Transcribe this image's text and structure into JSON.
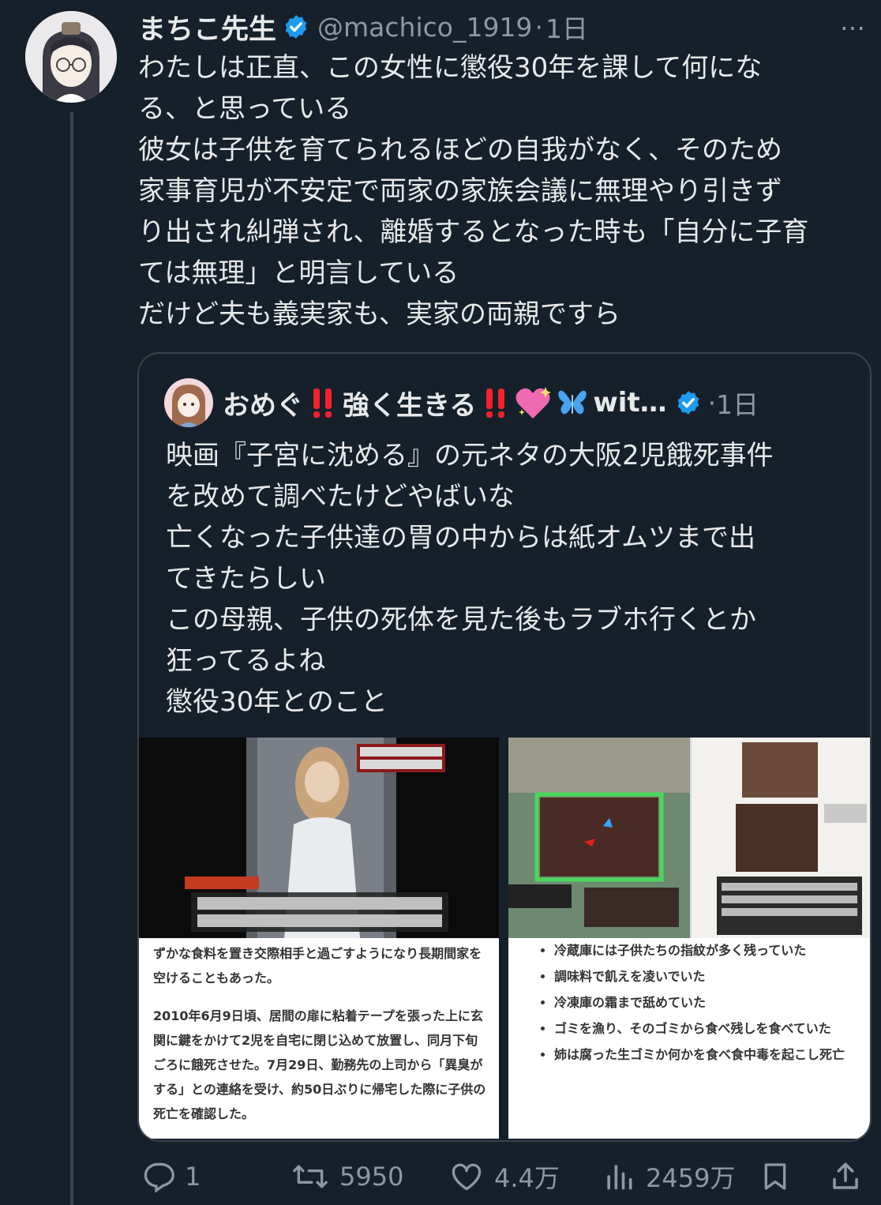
{
  "tweet": {
    "author": {
      "display_name": "まちこ先生",
      "handle": "@machico_1919",
      "verified": true
    },
    "separator": "·",
    "time": "1日",
    "more_label": "…",
    "text_lines": [
      "わたしは正直、この女性に懲役30年を課して何にな",
      "る、と思っている",
      "彼女は子供を育てられるほどの自我がなく、そのため",
      "家事育児が不安定で両家の家族会議に無理やり引きず",
      "り出され糾弾され、離婚するとなった時も「自分に子育",
      "ては無理」と明言している",
      "だけど夫も義実家も、実家の両親ですら"
    ]
  },
  "quoted_tweet": {
    "author": {
      "display_name": "おめぐ",
      "name_mid": "強く生きる",
      "name_tail": "wit…",
      "verified": true,
      "emoji_icons": [
        "double-exclamation-icon",
        "sparkling-heart-icon",
        "butterfly-icon"
      ]
    },
    "separator": "·",
    "time": "1日",
    "text_lines": [
      "映画『子宮に沈める』の元ネタの大阪2児餓死事件",
      "を改めて調べたけどやばいな",
      "亡くなった子供達の胃の中からは紙オムツまで出",
      "てきたらしい",
      "この母親、子供の死体を見た後もラブホ行くとか",
      "狂ってるよね",
      "懲役30年とのこと"
    ],
    "media": {
      "left_article": {
        "paragraphs": [
          "ずかな食料を置き交際相手と過ごすようになり長期間家を空けることもあった。",
          "2010年6月9日頃、居間の扉に粘着テープを張った上に玄関に鍵をかけて2児を自宅に閉じ込めて放置し、同月下旬ごろに餓死させた。7月29日、勤務先の上司から「異臭がする」との連絡を受け、約50日ぶりに帰宅した際に子供の死亡を確認した。"
        ]
      },
      "right_article": {
        "items": [
          "冷蔵庫には子供たちの指紋が多く残っていた",
          "調味料で飢えを凌いでいた",
          "冷凍庫の霜まで舐めていた",
          "ゴミを漁り、そのゴミから食べ残しを食べていた",
          "姉は腐った生ゴミか何かを食べ食中毒を起こし死亡"
        ]
      }
    }
  },
  "actions": {
    "replies": "1",
    "reposts": "5950",
    "likes": "4.4万",
    "views": "2459万"
  },
  "colors": {
    "background": "#15202b",
    "text": "#e7e9ea",
    "muted": "#8b98a5",
    "border": "#38444d",
    "verified": "#1d9bf0",
    "exclamation": "#f4212e"
  }
}
